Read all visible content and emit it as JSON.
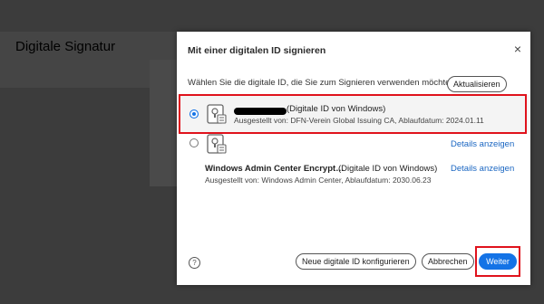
{
  "background": {
    "title": "Digitale Signatur"
  },
  "dialog": {
    "title": "Mit einer digitalen ID signieren",
    "close_symbol": "×",
    "instruction": "Wählen Sie die digitale ID, die Sie zum Signieren verwenden möchten:",
    "refresh_label": "Aktualisieren",
    "ids": [
      {
        "name_suffix": "(Digitale ID von Windows)",
        "issuer": "Ausgestellt von: DFN-Verein Global Issuing CA, Ablaufdatum: 2024.01.11",
        "selected": true
      },
      {
        "details_label": "Details anzeigen",
        "selected": false
      },
      {
        "name": "Windows Admin Center Encrypt…",
        "name_suffix": "(Digitale ID von Windows)",
        "issuer": "Ausgestellt von: Windows Admin Center, Ablaufdatum: 2030.06.23",
        "details_label": "Details anzeigen"
      }
    ],
    "help_symbol": "?",
    "new_id_label": "Neue digitale ID konfigurieren",
    "cancel_label": "Abbrechen",
    "continue_label": "Weiter"
  },
  "icons": [
    "certificate-icon",
    "help-icon",
    "close-icon"
  ],
  "colors": {
    "accent": "#1473e6",
    "highlight": "#e0121c",
    "link": "#1a66c2"
  }
}
